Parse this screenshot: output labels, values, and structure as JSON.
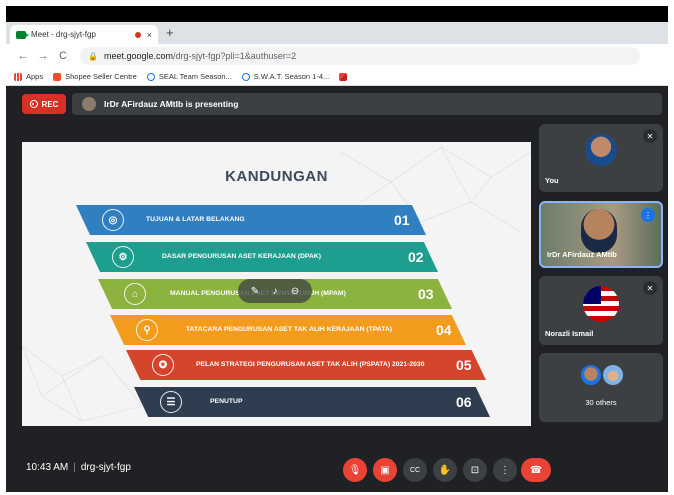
{
  "browser": {
    "tab_title": "Meet - drg-sjyt-fgp",
    "tab_close": "×",
    "new_tab": "+",
    "url_host": "meet.google.com",
    "url_path": "/drg-sjyt-fgp?pli=1&authuser=2",
    "bookmarks": [
      {
        "label": "Apps",
        "color": "#ea4335"
      },
      {
        "label": "Shopee Seller Centre",
        "color": "#ee4d2d"
      },
      {
        "label": "SEAL Team Season...",
        "color": "#1a73e8"
      },
      {
        "label": "S.W.A.T. Season 1-4...",
        "color": "#1a73e8"
      },
      {
        "label": "",
        "color": "#ea4335"
      }
    ]
  },
  "meet": {
    "rec_label": "REC",
    "presenting_text": "IrDr AFirdauz AMtIb is presenting",
    "meeting_time": "10:43 AM",
    "meeting_code": "drg-sjyt-fgp"
  },
  "slide": {
    "title": "KANDUNGAN",
    "items": [
      {
        "text": "TUJUAN & LATAR BELAKANG",
        "num": "01",
        "color": "#2f7fc1"
      },
      {
        "text": "DASAR PENGURUSAN ASET KERAJAAN (DPAK)",
        "num": "02",
        "color": "#1e9e8f"
      },
      {
        "text": "MANUAL PENGURUSAN ASET MENYELURUH (MPAM)",
        "num": "03",
        "color": "#8cb23f"
      },
      {
        "text": "TATACARA PENGURUSAN ASET TAK ALIH KERAJAAN (TPATA)",
        "num": "04",
        "color": "#f29b1d"
      },
      {
        "text": "PELAN STRATEGI PENGURUSAN ASET TAK ALIH (PSPATA) 2021-2030",
        "num": "05",
        "color": "#d5452b"
      },
      {
        "text": "PENUTUP",
        "num": "06",
        "color": "#2e3e50"
      }
    ]
  },
  "participants": [
    {
      "name": "You"
    },
    {
      "name": "IrDr AFirdauz AMtIb"
    },
    {
      "name": "Norazli Ismail"
    },
    {
      "name": "30 others"
    }
  ]
}
